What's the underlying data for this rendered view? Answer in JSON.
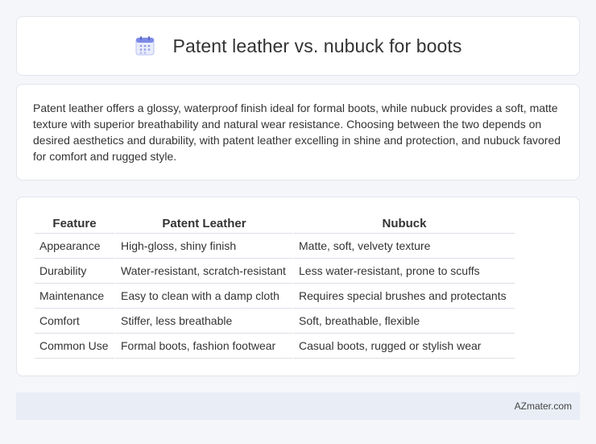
{
  "header": {
    "title": "Patent leather vs. nubuck for boots",
    "icon": "calendar-icon"
  },
  "summary": {
    "text": "Patent leather offers a glossy, waterproof finish ideal for formal boots, while nubuck provides a soft, matte texture with superior breathability and natural wear resistance. Choosing between the two depends on desired aesthetics and durability, with patent leather excelling in shine and protection, and nubuck favored for comfort and rugged style."
  },
  "table": {
    "headers": [
      "Feature",
      "Patent Leather",
      "Nubuck"
    ],
    "rows": [
      [
        "Appearance",
        "High-gloss, shiny finish",
        "Matte, soft, velvety texture"
      ],
      [
        "Durability",
        "Water-resistant, scratch-resistant",
        "Less water-resistant, prone to scuffs"
      ],
      [
        "Maintenance",
        "Easy to clean with a damp cloth",
        "Requires special brushes and protectants"
      ],
      [
        "Comfort",
        "Stiffer, less breathable",
        "Soft, breathable, flexible"
      ],
      [
        "Common Use",
        "Formal boots, fashion footwear",
        "Casual boots, rugged or stylish wear"
      ]
    ]
  },
  "footer": {
    "text": "AZmater.com"
  },
  "colors": {
    "background": "#f5f6fa",
    "card": "#ffffff",
    "footer_bg": "#e8edf6",
    "icon_accent": "#6c7ae0"
  }
}
